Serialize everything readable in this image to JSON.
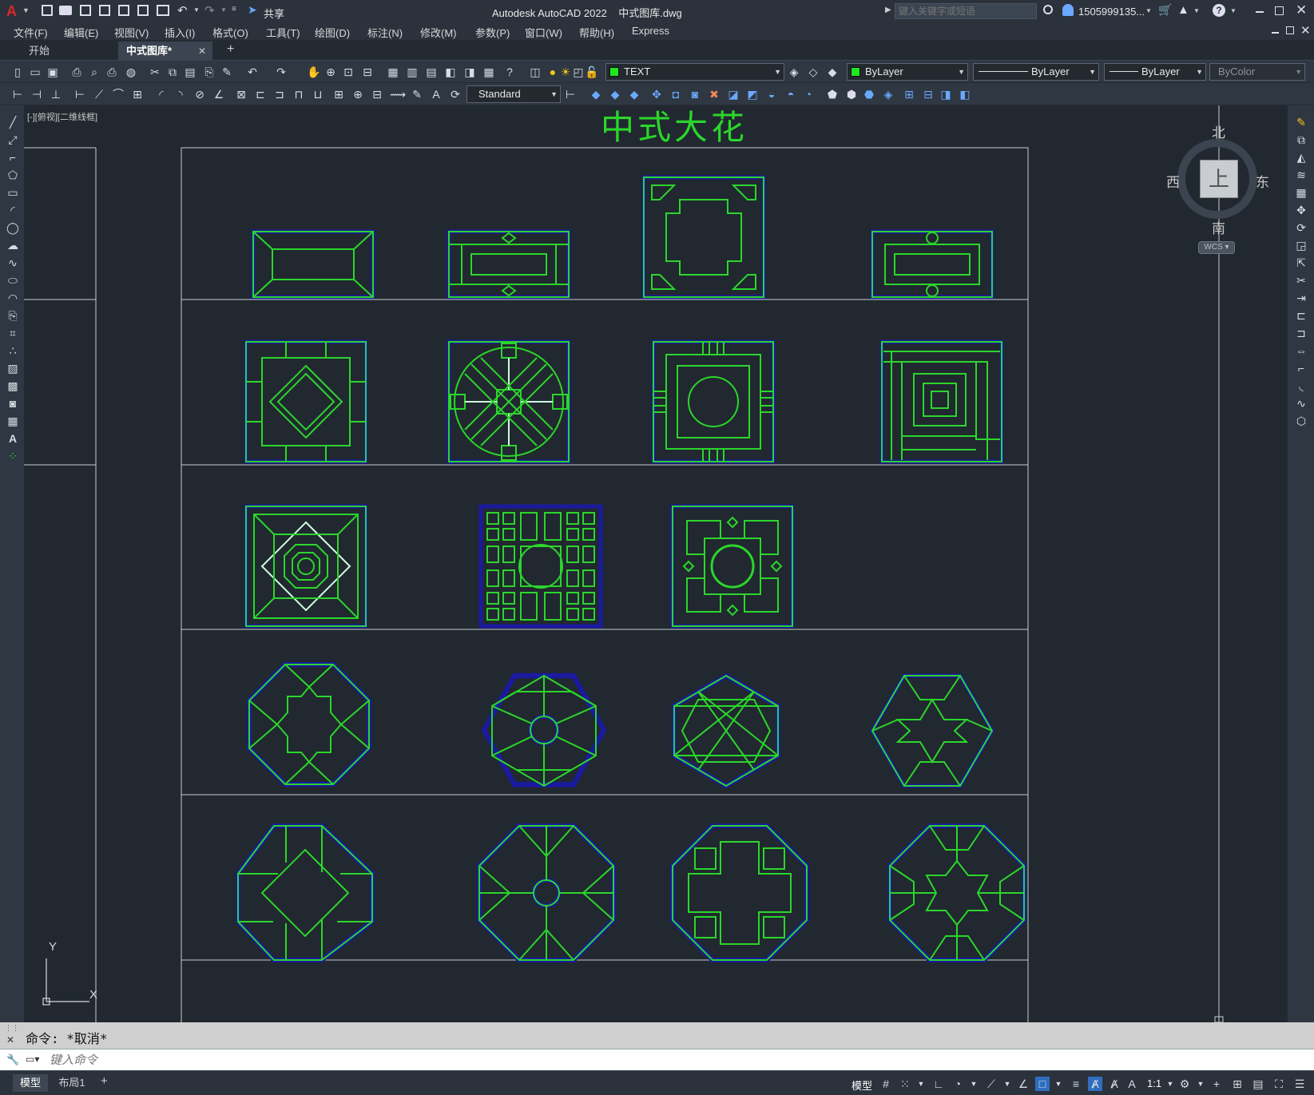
{
  "titlebar": {
    "app_logo": "A",
    "app_name": "Autodesk AutoCAD 2022",
    "doc_name": "中式图库.dwg",
    "share_label": "共享",
    "search_placeholder": "键入关键字或短语",
    "user_name": "1505999135..."
  },
  "menu": [
    "文件(F)",
    "编辑(E)",
    "视图(V)",
    "插入(I)",
    "格式(O)",
    "工具(T)",
    "绘图(D)",
    "标注(N)",
    "修改(M)",
    "参数(P)",
    "窗口(W)",
    "帮助(H)",
    "Express"
  ],
  "tabs": {
    "start": "开始",
    "active": "中式图库*",
    "new_tab": "+"
  },
  "properties": {
    "layer": "TEXT",
    "color": "ByLayer",
    "linetype": "ByLayer",
    "lineweight": "ByLayer",
    "plotstyle": "ByColor",
    "text_style": "Standard",
    "layer_color": "#1ee81e"
  },
  "viewport": {
    "label": "[-][俯视][二维线框]",
    "drawing_title": "中式大花",
    "ucs_x": "X",
    "ucs_y": "Y"
  },
  "viewcube": {
    "north": "北",
    "south": "南",
    "east": "东",
    "west": "西",
    "top": "上",
    "wcs": "WCS"
  },
  "command": {
    "history": "命令:  *取消*",
    "placeholder": "键入命令"
  },
  "layout_tabs": {
    "model": "模型",
    "layout1": "布局1",
    "add": "+"
  },
  "status": {
    "model_label": "模型",
    "scale": "1:1"
  },
  "colors": {
    "drawing_green": "#2bd62b",
    "drawing_blue": "#1a1aa0",
    "background": "#212830"
  }
}
